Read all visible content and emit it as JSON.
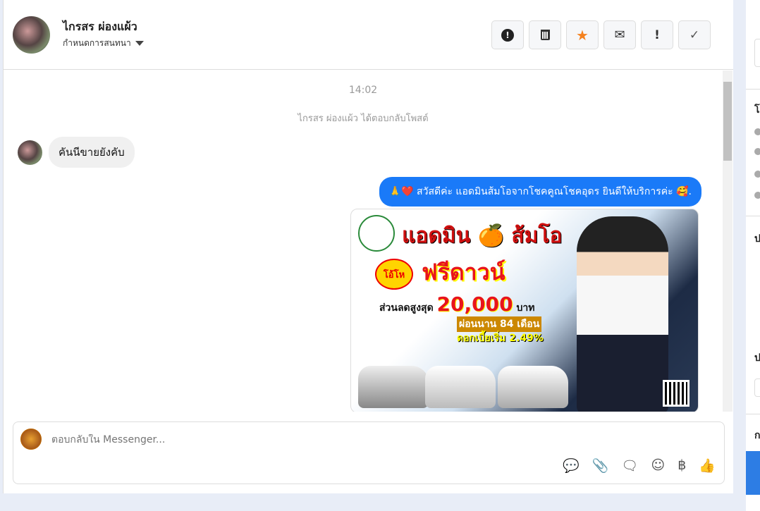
{
  "header": {
    "contact_name": "ไกรสร ผ่องแผ้ว",
    "subtitle": "กำหนดการสนทนา",
    "actions": [
      {
        "name": "spam-button",
        "icon": "exclamation-circle-icon",
        "glyph": "⬤"
      },
      {
        "name": "delete-button",
        "icon": "trash-icon",
        "glyph": "🗑"
      },
      {
        "name": "star-button",
        "icon": "star-icon",
        "glyph": "★"
      },
      {
        "name": "mark-unread-button",
        "icon": "envelope-open-icon",
        "glyph": "✉"
      },
      {
        "name": "important-button",
        "icon": "exclamation-icon",
        "glyph": "!"
      },
      {
        "name": "done-button",
        "icon": "check-icon",
        "glyph": "✓"
      }
    ]
  },
  "chat": {
    "timestamp": "14:02",
    "system_message": "ไกรสร ผ่องแผ้ว ได้ตอบกลับโพสต์",
    "incoming": "คันนีขายยังคับ",
    "outgoing": "🙏❤️ สวัสดีค่ะ แอดมินส้มโอจากโชคคูณโชคอุดร ยินดีให้บริการค่ะ 🥰.",
    "ad_image": {
      "headline": "แอดมิน 🍊 ส้มโอ",
      "badge": "โอ้โห",
      "offer": "ฟรีดาวน์",
      "discount_label": "ส่วนลดสูงสุด",
      "discount_value": "20,000",
      "discount_unit": "บาท",
      "installment": "ผ่อนนาน 84 เดือน",
      "interest": "ดอกเบี้ยเริ่ม 2.49%"
    }
  },
  "composer": {
    "placeholder": "ตอบกลับใน Messenger...",
    "icons": [
      {
        "name": "saved-reply-icon",
        "glyph": "💬"
      },
      {
        "name": "attachment-icon",
        "glyph": "📎"
      },
      {
        "name": "quick-reply-icon",
        "glyph": "🗨"
      },
      {
        "name": "emoji-icon",
        "glyph": "☺"
      },
      {
        "name": "payment-baht-icon",
        "glyph": "฿"
      },
      {
        "name": "like-icon",
        "glyph": "👍"
      }
    ]
  },
  "right_panel": {
    "headings": [
      "โ",
      "ป",
      "ป",
      "ก"
    ]
  },
  "colors": {
    "accent": "#1a7af8",
    "star": "#f5821f"
  }
}
